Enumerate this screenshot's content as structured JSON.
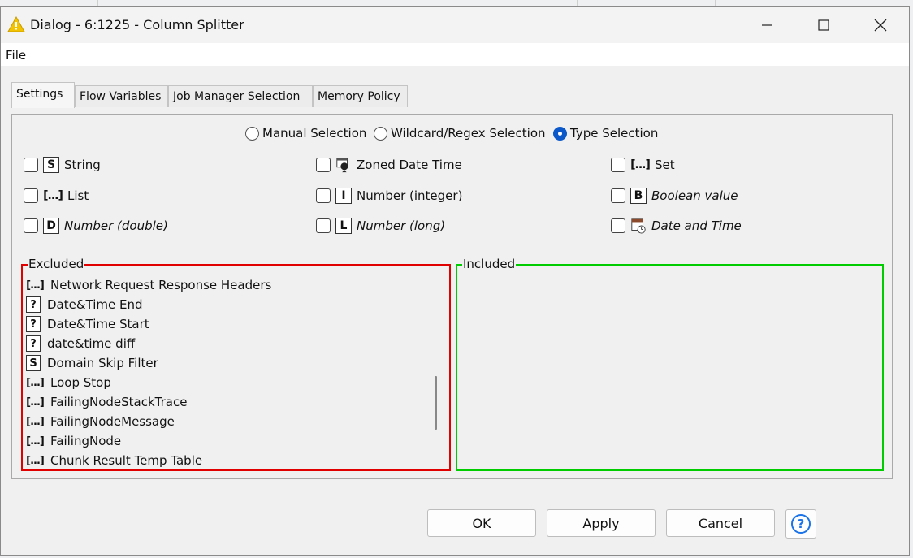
{
  "window": {
    "title": "Dialog - 6:1225 - Column Splitter",
    "minimize_label": "—",
    "maximize_label": "☐",
    "close_label": "✕"
  },
  "menu": {
    "file": "File"
  },
  "tabs": [
    {
      "label": "Settings",
      "active": true
    },
    {
      "label": "Flow Variables",
      "active": false
    },
    {
      "label": "Job Manager Selection",
      "active": false
    },
    {
      "label": "Memory Policy",
      "active": false
    }
  ],
  "selection_modes": {
    "manual": "Manual Selection",
    "wildcard": "Wildcard/Regex Selection",
    "type": "Type Selection",
    "selected": "type"
  },
  "types": [
    {
      "label": "String",
      "badge": "S",
      "italic": false,
      "checked": false
    },
    {
      "label": "Zoned Date Time",
      "badge": "",
      "icon": "zoned-datetime-icon",
      "italic": false,
      "checked": false
    },
    {
      "label": "Set",
      "badge": "[...]",
      "italic": false,
      "checked": false
    },
    {
      "label": "List",
      "badge": "[...]",
      "italic": false,
      "checked": false
    },
    {
      "label": "Number (integer)",
      "badge": "I",
      "italic": false,
      "checked": false
    },
    {
      "label": "Boolean value",
      "badge": "B",
      "italic": true,
      "checked": false
    },
    {
      "label": "Number (double)",
      "badge": "D",
      "italic": true,
      "checked": false
    },
    {
      "label": "Number (long)",
      "badge": "L",
      "italic": true,
      "checked": false
    },
    {
      "label": "Date and Time",
      "badge": "",
      "icon": "calendar-clock-icon",
      "italic": true,
      "checked": false
    }
  ],
  "excluded": {
    "legend": "Excluded",
    "border_color": "#e00000",
    "items": [
      {
        "label": "Network Request Response Headers",
        "badge": "[...]"
      },
      {
        "label": "Date&Time End",
        "badge": "?"
      },
      {
        "label": "Date&Time Start",
        "badge": "?"
      },
      {
        "label": "date&time diff",
        "badge": "?"
      },
      {
        "label": "Domain Skip Filter",
        "badge": "S"
      },
      {
        "label": "Loop Stop",
        "badge": "[...]"
      },
      {
        "label": "FailingNodeStackTrace",
        "badge": "[...]"
      },
      {
        "label": "FailingNodeMessage",
        "badge": "[...]"
      },
      {
        "label": "FailingNode",
        "badge": "[...]"
      },
      {
        "label": "Chunk Result Temp Table",
        "badge": "[...]"
      }
    ]
  },
  "included": {
    "legend": "Included",
    "border_color": "#00cc00",
    "items": []
  },
  "buttons": {
    "ok": "OK",
    "apply": "Apply",
    "cancel": "Cancel",
    "help": "?"
  },
  "colors": {
    "accent": "#0a58c9",
    "warning_icon": "#f2c300",
    "help": "#1a73e8"
  }
}
